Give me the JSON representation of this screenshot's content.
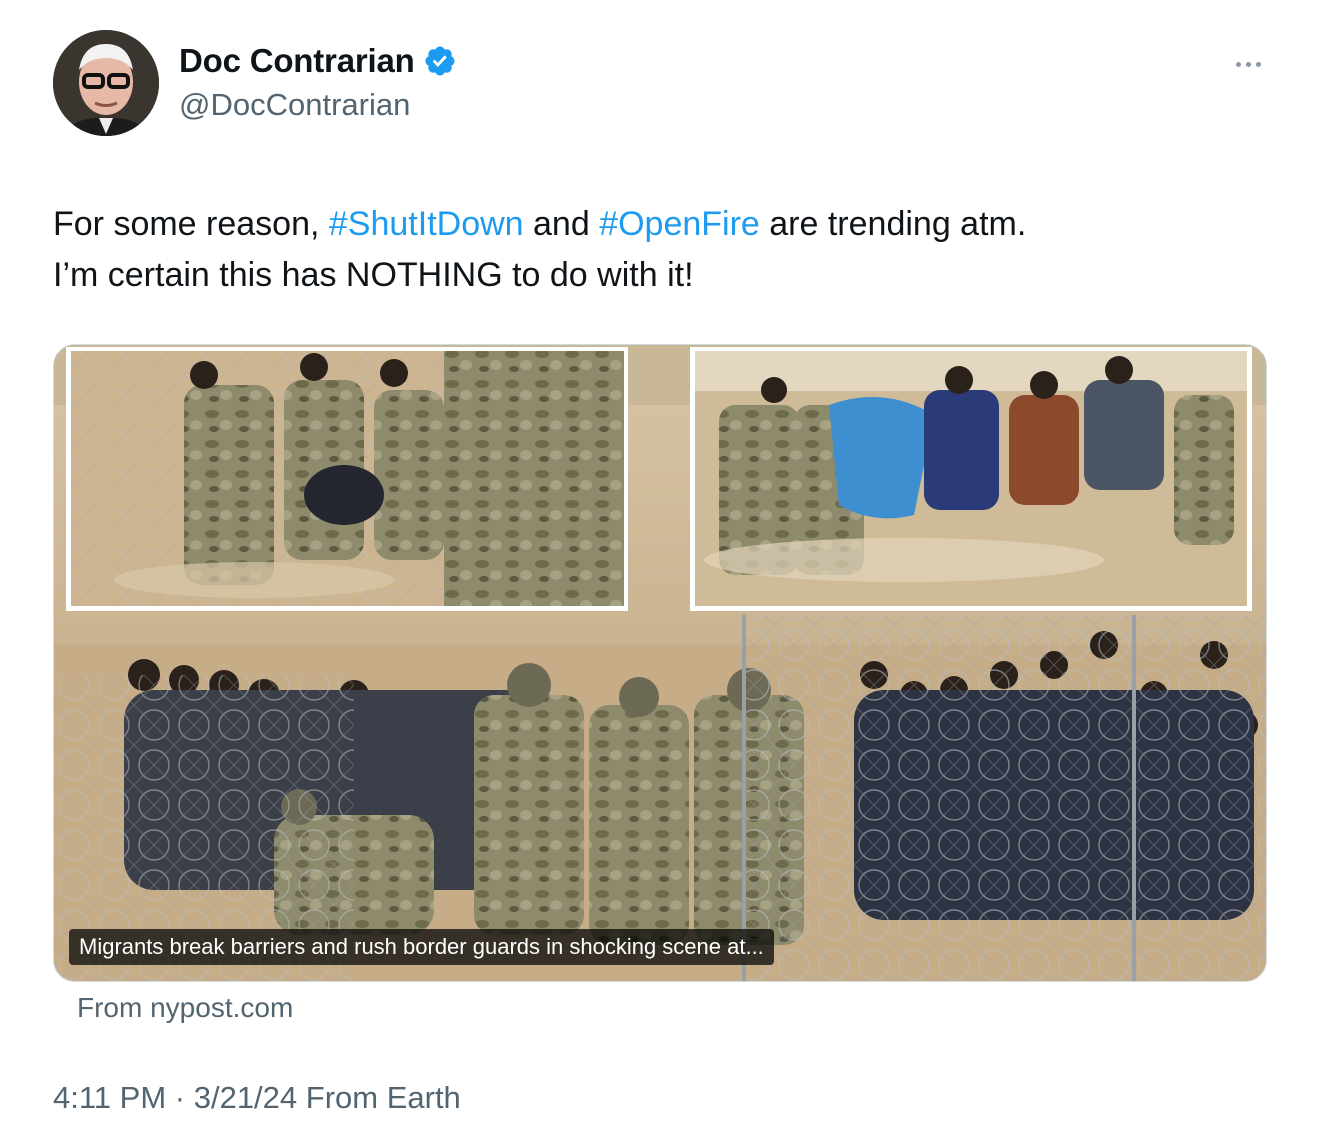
{
  "author": {
    "display_name": "Doc Contrarian",
    "handle": "@DocContrarian",
    "verified": true
  },
  "tweet": {
    "text_line1_a": "For some reason, ",
    "hashtag1": "#ShutItDown",
    "text_line1_b": " and ",
    "hashtag2": "#OpenFire",
    "text_line1_c": " are trending atm.",
    "text_line2": "I’m certain this has NOTHING to do with it!"
  },
  "card": {
    "caption": "Migrants break barriers and rush border guards in shocking scene at...",
    "source": "From nypost.com"
  },
  "meta": {
    "time": "4:11 PM",
    "separator": " · ",
    "date": "3/21/24",
    "client": " From Earth"
  },
  "icons": {
    "verified": "verified-badge-icon",
    "more": "more-horizontal-icon"
  },
  "colors": {
    "accent": "#1d9bf0",
    "secondary_text": "#536471",
    "primary_text": "#0f1419"
  }
}
